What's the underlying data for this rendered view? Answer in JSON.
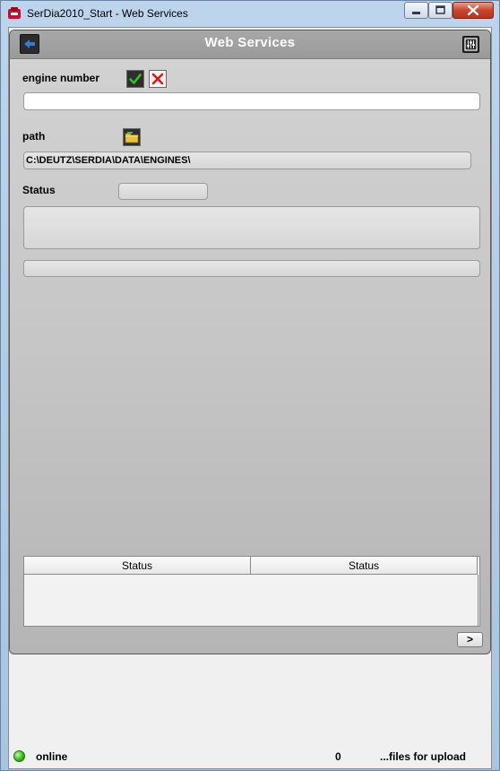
{
  "window": {
    "title": "SerDia2010_Start - Web Services",
    "icon": "serdia-app-icon"
  },
  "panel": {
    "title": "Web Services",
    "back_icon": "back-arrow-icon",
    "settings_icon": "settings-sliders-icon"
  },
  "engine": {
    "label": "engine number",
    "value": "",
    "confirm_icon": "checkmark-icon",
    "clear_icon": "red-x-icon"
  },
  "path": {
    "label": "path",
    "value": "C:\\DEUTZ\\SERDIA\\DATA\\ENGINES\\",
    "browse_icon": "folder-icon"
  },
  "status": {
    "label": "Status",
    "value": "",
    "message": "",
    "progress": 0
  },
  "table": {
    "columns": [
      "Status",
      "Status"
    ],
    "rows": []
  },
  "navigation": {
    "next_label": ">"
  },
  "statusbar": {
    "connection": "online",
    "connection_color": "#2fbf14",
    "file_count": "0",
    "files_label": "...files for upload"
  }
}
